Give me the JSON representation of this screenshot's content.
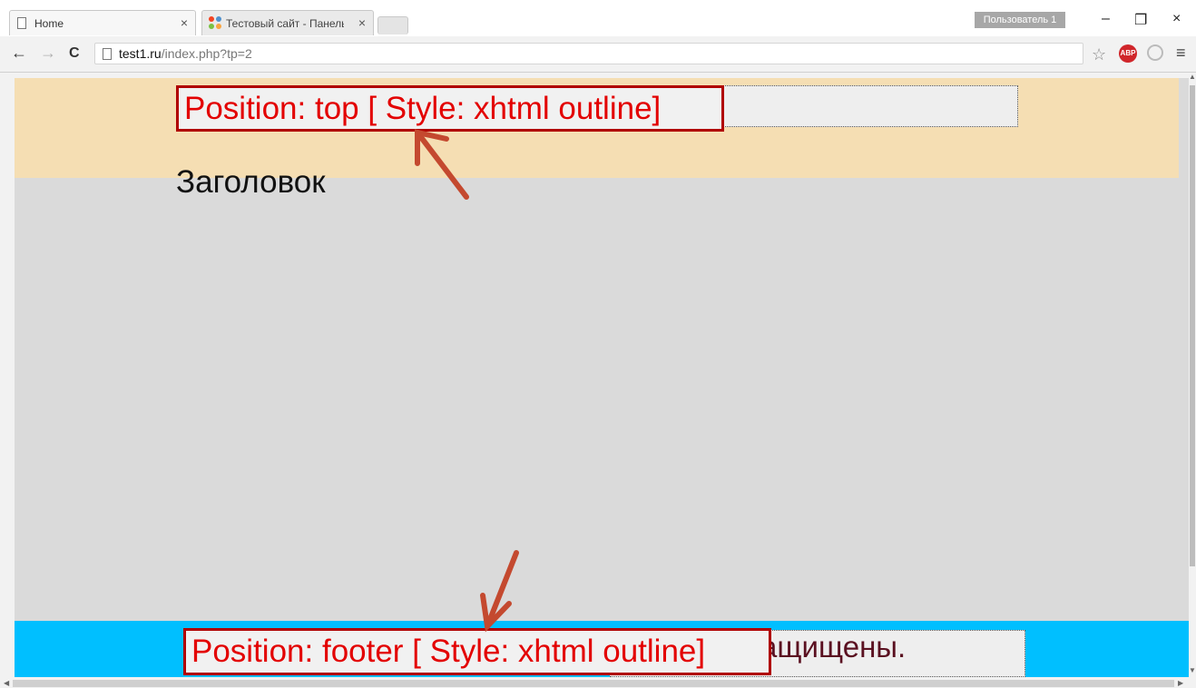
{
  "browser": {
    "tabs": [
      {
        "title": "Home",
        "close": "×"
      },
      {
        "title": "Тестовый сайт - Панель у",
        "close": "×"
      }
    ],
    "profile": "Пользователь 1",
    "window_controls": {
      "minimize": "–",
      "restore": "❐",
      "close": "×"
    },
    "nav": {
      "back": "←",
      "forward": "→",
      "reload": "C"
    },
    "url": {
      "host": "test1.ru",
      "path": "/index.php?tp=2"
    },
    "star": "☆",
    "abp_label": "ABP",
    "menu": "≡",
    "icons": [
      "page-icon",
      "joomla-icon",
      "star-icon",
      "adblock-plus-icon",
      "extension-icon",
      "menu-icon"
    ]
  },
  "page": {
    "top_label": "Position: top [ Style: xhtml outline]",
    "heading": "Заголовок",
    "footer_label": "Position: footer [ Style: xhtml outline]",
    "footer_text": "ащищены."
  },
  "colors": {
    "header_band": "#f5deb3",
    "footer_band": "#00bfff",
    "label_text": "#e30000",
    "arrow": "#c4492f"
  }
}
